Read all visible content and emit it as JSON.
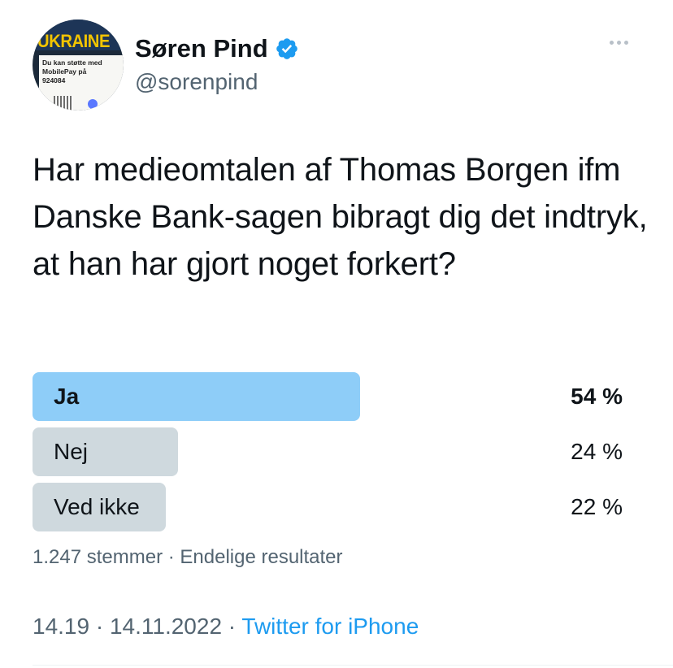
{
  "author": {
    "display_name": "Søren Pind",
    "handle": "@sorenpind",
    "verified": true,
    "avatar": {
      "banner_text": "UKRAINE",
      "card_text": "Du kan støtte med MobilePay på 924084"
    }
  },
  "tweet": {
    "text": "Har medieomtalen af Thomas Borgen ifm Danske Bank-sagen bibragt dig det indtryk, at han har gjort noget forkert?"
  },
  "poll": {
    "options": [
      {
        "label": "Ja",
        "percent_text": "54 %",
        "percent": 54,
        "winner": true
      },
      {
        "label": "Nej",
        "percent_text": "24 %",
        "percent": 24,
        "winner": false
      },
      {
        "label": "Ved ikke",
        "percent_text": "22 %",
        "percent": 22,
        "winner": false
      }
    ],
    "meta": "1.247 stemmer · Endelige resultater"
  },
  "footer": {
    "time_date": "14.19 · 14.11.2022 · ",
    "source": "Twitter for iPhone"
  },
  "colors": {
    "accent": "#1d9bf0",
    "winner_bar": "#8ecdf8",
    "other_bar": "#cfd9de",
    "secondary_text": "#536471"
  },
  "icons": {
    "verified": "verified-badge-icon",
    "more": "more-options-icon"
  }
}
